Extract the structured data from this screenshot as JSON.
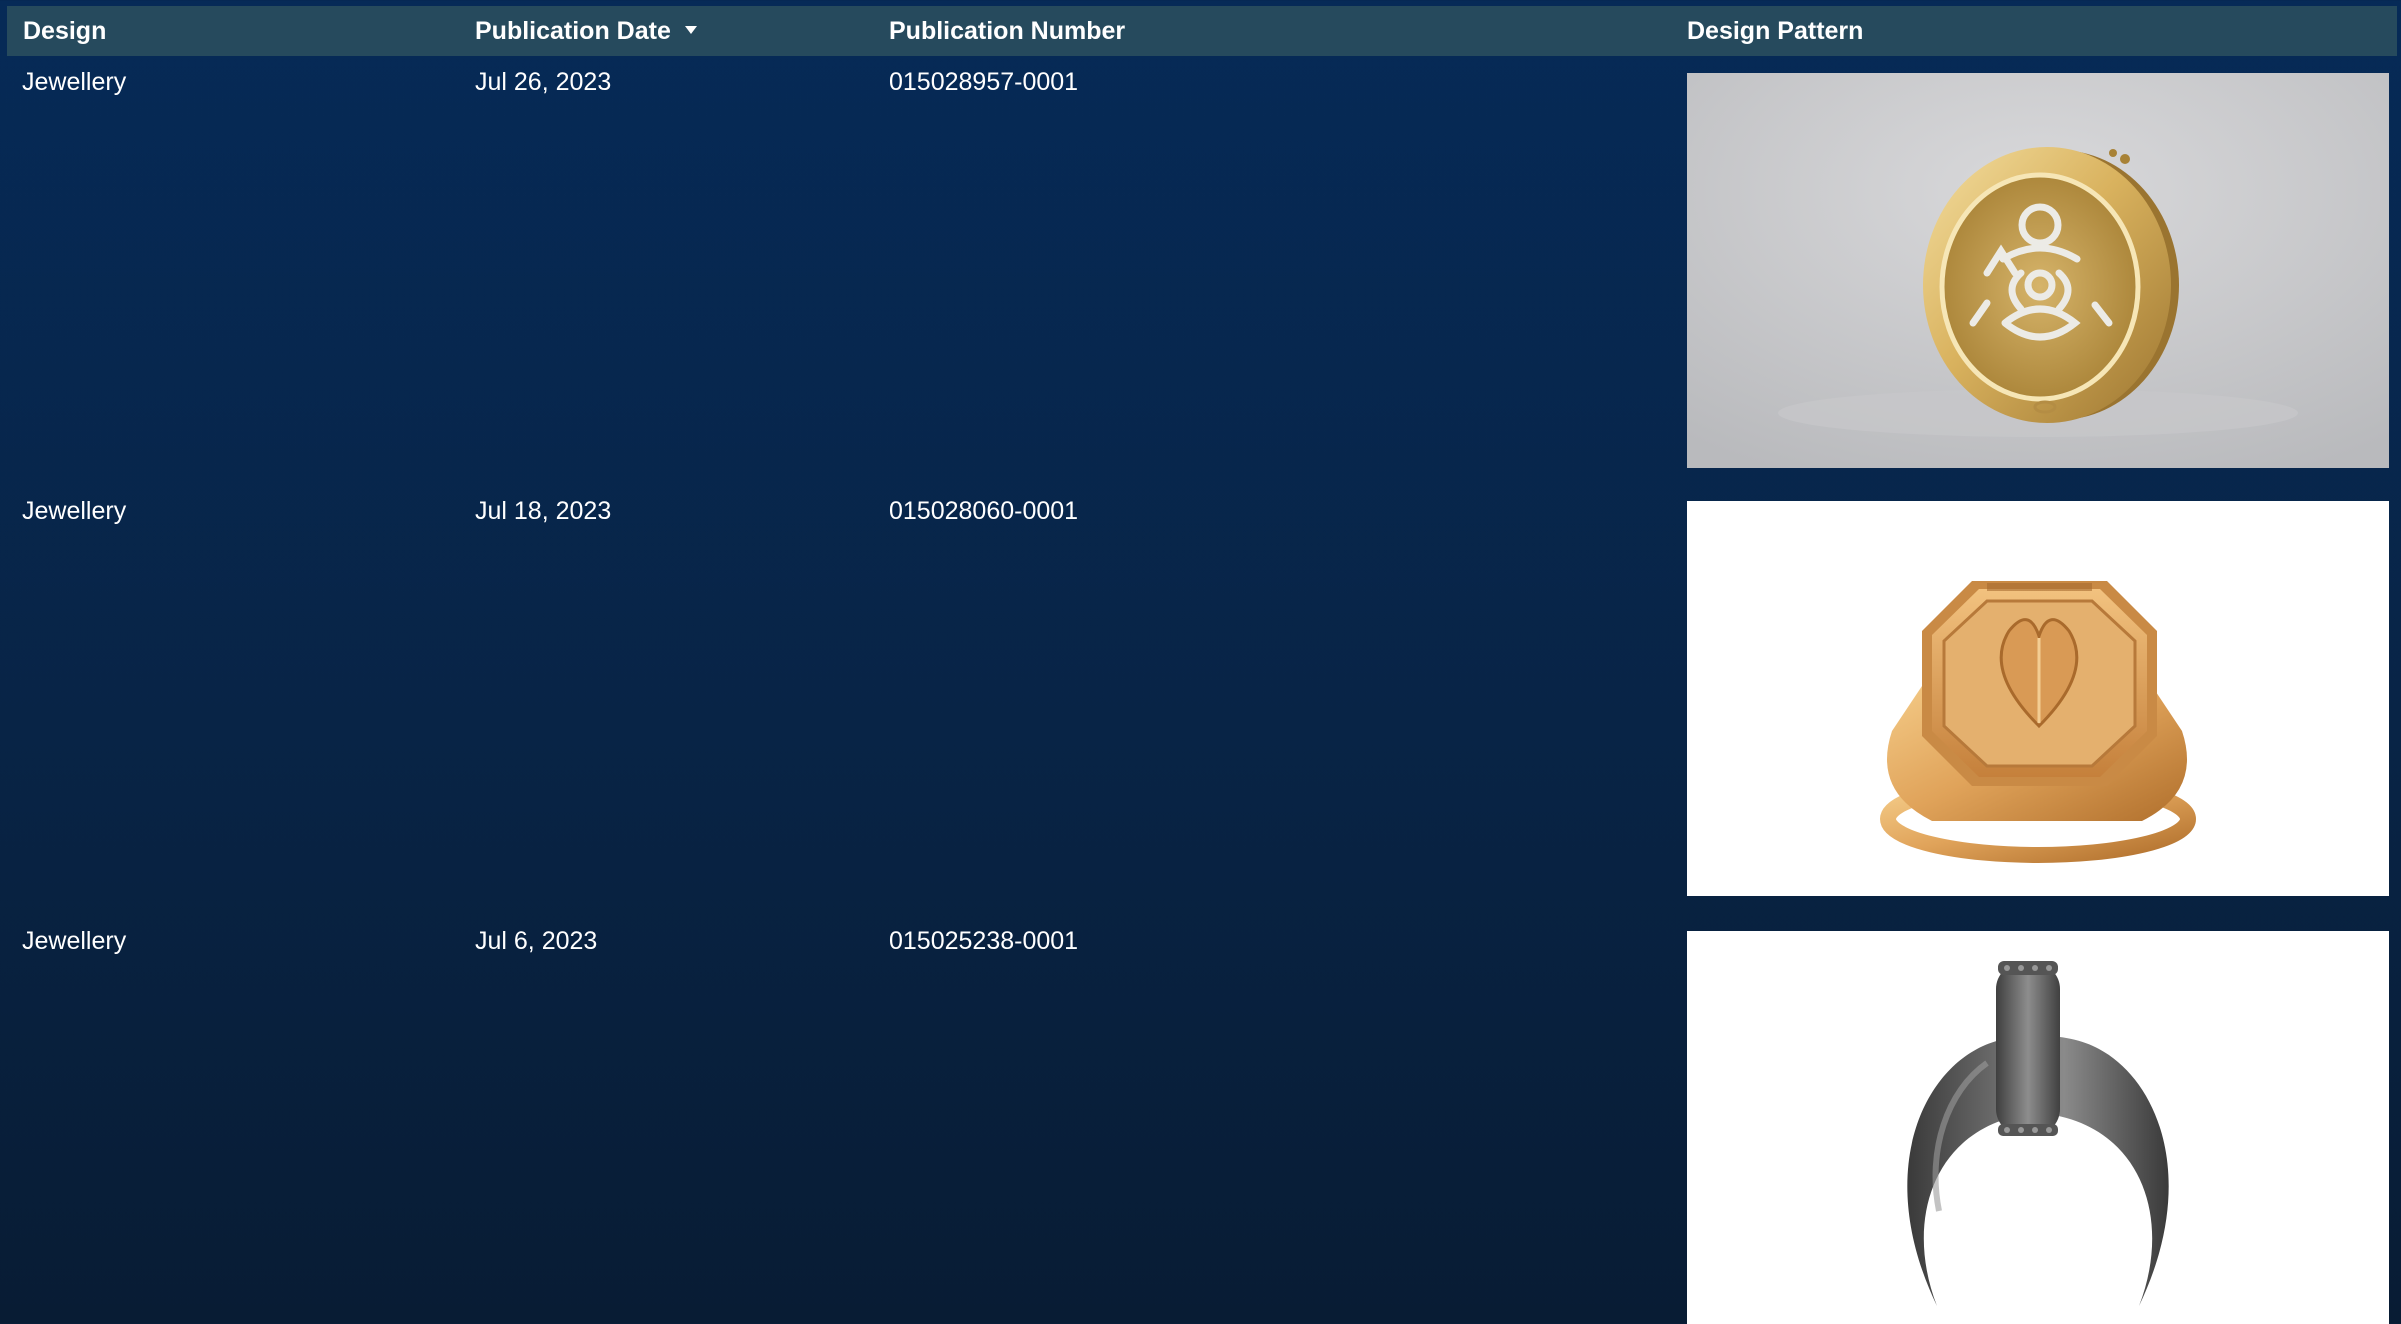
{
  "columns": {
    "design": "Design",
    "publication_date": "Publication Date",
    "publication_number": "Publication Number",
    "design_pattern": "Design Pattern"
  },
  "sort": {
    "column": "publication_date",
    "direction": "descending"
  },
  "rows": [
    {
      "design": "Jewellery",
      "publication_date": "Jul 26, 2023",
      "publication_number": "015028957-0001",
      "image": "gold-round-seal-pendant"
    },
    {
      "design": "Jewellery",
      "publication_date": "Jul 18, 2023",
      "publication_number": "015028060-0001",
      "image": "gold-heart-signet-ring"
    },
    {
      "design": "Jewellery",
      "publication_date": "Jul 6, 2023",
      "publication_number": "015025238-0001",
      "image": "dark-crescent-horn-pendant"
    }
  ],
  "colors": {
    "header_bg": "#264a5d",
    "page_bg_top": "#062a57",
    "page_bg_bottom": "#081c34",
    "text": "#ffffff"
  }
}
